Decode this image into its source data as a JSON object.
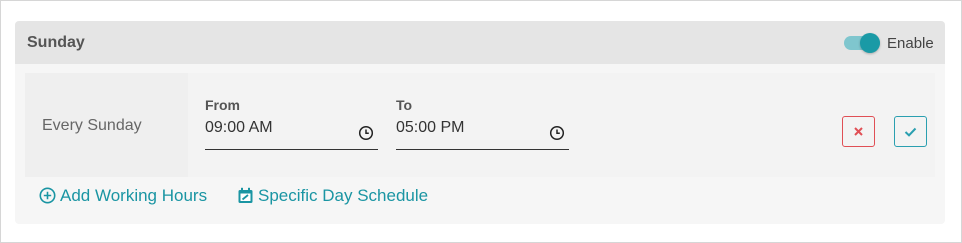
{
  "day": {
    "title": "Sunday",
    "enable_label": "Enable",
    "enabled": true
  },
  "schedule_row": {
    "label": "Every Sunday",
    "from": {
      "label": "From",
      "value": "09:00 AM"
    },
    "to": {
      "label": "To",
      "value": "05:00 PM"
    }
  },
  "actions": {
    "add_working_hours": "Add Working Hours",
    "specific_day_schedule": "Specific Day Schedule"
  },
  "icons": {
    "clock": "clock-icon",
    "cancel": "close-icon",
    "confirm": "check-icon",
    "add": "plus-circle-icon",
    "calendar": "calendar-edit-icon"
  },
  "colors": {
    "accent": "#1a9aa6",
    "toggle_track": "#7fc6ce",
    "cancel_border": "#e04f55",
    "confirm_border": "#2a9fb0",
    "link": "#1a95a3"
  }
}
